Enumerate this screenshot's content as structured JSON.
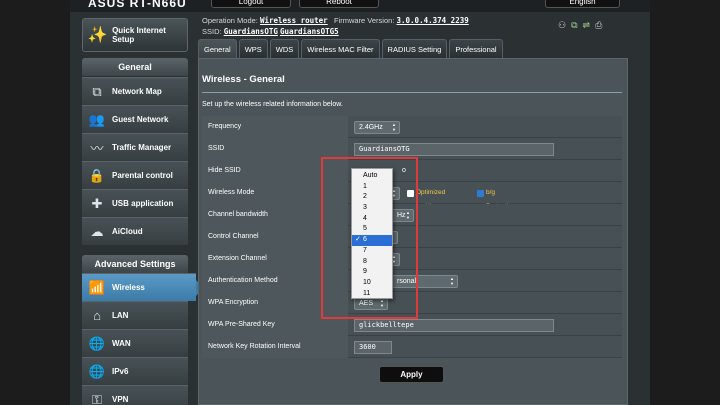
{
  "header": {
    "logo": "ASUS RT-N66U",
    "logout_label": "Logout",
    "reboot_label": "Reboot",
    "language": "English",
    "operation_mode_label": "Operation Mode:",
    "operation_mode_value": "Wireless router",
    "firmware_label": "Firmware Version:",
    "firmware_value": "3.0.0.4.374_2239",
    "ssid_label": "SSID:",
    "ssid_1": "GuardiansOTG",
    "ssid_2": "GuardiansOTG5"
  },
  "sidebar": {
    "quick_setup": "Quick Internet Setup",
    "general_head": "General",
    "general_items": [
      {
        "label": "Network Map",
        "icon": "network-map-icon",
        "glyph": "⧉"
      },
      {
        "label": "Guest Network",
        "icon": "guest-network-icon",
        "glyph": "👥"
      },
      {
        "label": "Traffic Manager",
        "icon": "traffic-manager-icon",
        "glyph": "〰"
      },
      {
        "label": "Parental control",
        "icon": "lock-icon",
        "glyph": "🔒"
      },
      {
        "label": "USB application",
        "icon": "puzzle-icon",
        "glyph": "✚"
      },
      {
        "label": "AiCloud",
        "icon": "cloud-icon",
        "glyph": "☁"
      }
    ],
    "advanced_head": "Advanced Settings",
    "advanced_items": [
      {
        "label": "Wireless",
        "icon": "wireless-icon",
        "glyph": "📶",
        "active": true
      },
      {
        "label": "LAN",
        "icon": "home-icon",
        "glyph": "⌂"
      },
      {
        "label": "WAN",
        "icon": "globe-icon",
        "glyph": "🌐"
      },
      {
        "label": "IPv6",
        "icon": "globe-icon",
        "glyph": "🌐"
      },
      {
        "label": "VPN",
        "icon": "vpn-icon",
        "glyph": "⚿"
      }
    ]
  },
  "tabs": [
    "General",
    "WPS",
    "WDS",
    "Wireless MAC Filter",
    "RADIUS Setting",
    "Professional"
  ],
  "content": {
    "title": "Wireless - General",
    "description": "Set up the wireless related information below.",
    "rows": {
      "frequency": {
        "label": "Frequency",
        "value": "2.4GHz"
      },
      "ssid": {
        "label": "SSID",
        "value": "GuardiansOTG"
      },
      "hide_ssid": {
        "label": "Hide SSID",
        "value": "o"
      },
      "wireless_mode": {
        "label": "Wireless Mode",
        "value": "",
        "xbox_label": "Optimized for Xbox",
        "bg_label": "b/g Protection"
      },
      "channel_bandwidth": {
        "label": "Channel bandwidth",
        "value": "Hz"
      },
      "control_channel": {
        "label": "Control Channel",
        "value": ""
      },
      "extension_channel": {
        "label": "Extension Channel",
        "value": ""
      },
      "auth_method": {
        "label": "Authentication Method",
        "value": "rsonal"
      },
      "wpa_encryption": {
        "label": "WPA Encryption",
        "value": "AES"
      },
      "wpa_key": {
        "label": "WPA Pre-Shared Key",
        "value": "glickbelltepe"
      },
      "rotation": {
        "label": "Network Key Rotation Interval",
        "value": "3600"
      }
    },
    "apply_label": "Apply"
  },
  "channel_dropdown": {
    "options": [
      "Auto",
      "1",
      "2",
      "3",
      "4",
      "5",
      "6",
      "7",
      "8",
      "9",
      "10",
      "11"
    ],
    "selected": "6",
    "check": "✓"
  },
  "colors": {
    "highlight_box": "#e03a3a",
    "active_menu": "#4a8abb",
    "selected_option": "#2b6fd6"
  }
}
